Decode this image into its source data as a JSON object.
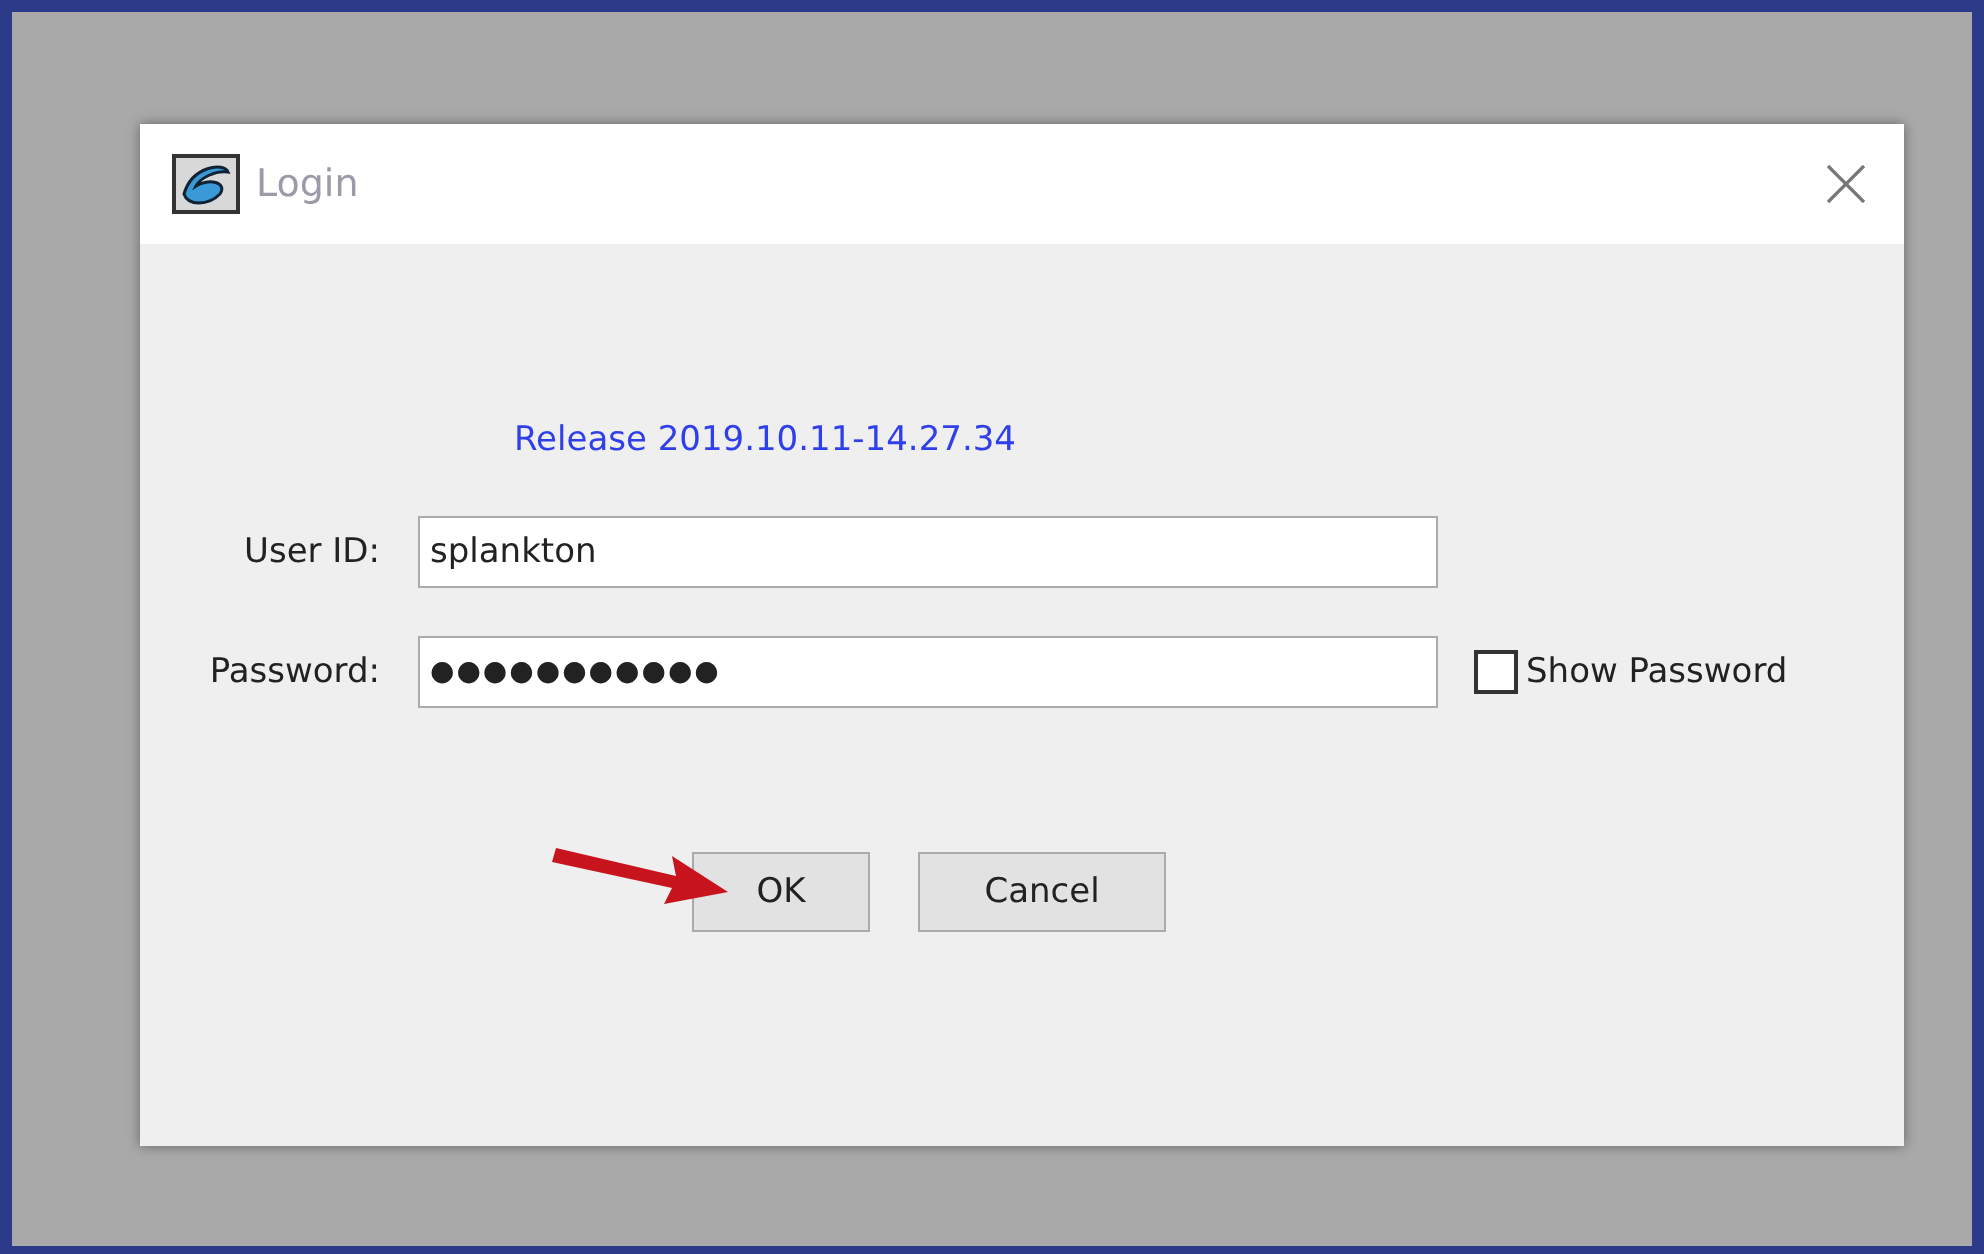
{
  "window": {
    "title": "Login"
  },
  "release": "Release 2019.10.11-14.27.34",
  "fields": [
    {
      "label": "User ID:",
      "value": "splankton"
    },
    {
      "label": "Password:",
      "value": "●●●●●●●●●●●"
    }
  ],
  "show_password": {
    "label": "Show Password",
    "checked": false
  },
  "buttons": [
    "OK",
    "Cancel"
  ]
}
